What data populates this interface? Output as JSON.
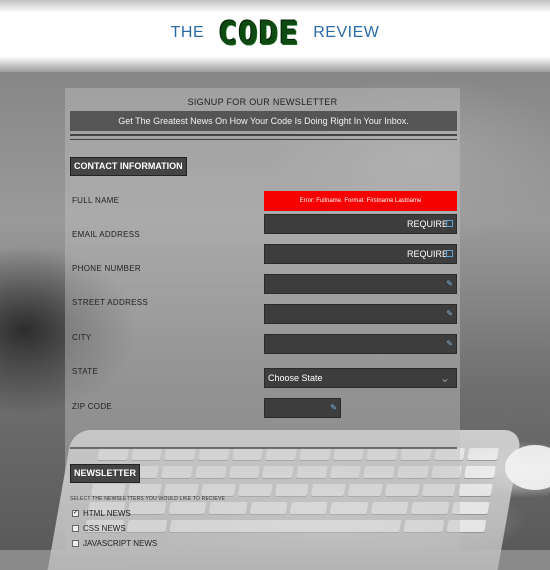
{
  "header": {
    "word_left": "THE",
    "logo": "CODE",
    "word_right": "REVIEW"
  },
  "signup": {
    "title": "SIGNUP FOR OUR NEWSLETTER",
    "tagline": "Get The Greatest News On How Your Code Is Doing Right In Your Inbox."
  },
  "contact": {
    "section_title": "CONTACT INFORMATION",
    "labels": {
      "full_name": "FULL NAME",
      "email": "EMAIL ADDRESS",
      "phone": "PHONE NUMBER",
      "street": "STREET ADDRESS",
      "city": "CITY",
      "state": "STATE",
      "zip": "ZIP CODE"
    },
    "error_message": "Error: Fullname. Format: Firstname Lastname",
    "required_text": "REQUIRE",
    "state_placeholder": "Choose State"
  },
  "newsletter": {
    "section_title": "NEWSLETTER",
    "instruction": "SELECT THE NEWSLETTERS YOU WOULD LIKE TO RECIEVE",
    "options": [
      {
        "label": "HTML NEWS",
        "checked": true
      },
      {
        "label": "CSS NEWS",
        "checked": false
      },
      {
        "label": "JAVASCRIPT NEWS",
        "checked": false
      }
    ]
  },
  "colors": {
    "brand_blue": "#2a6ba8",
    "logo_green": "#0f4a12",
    "error_red": "#f70000",
    "input_bg": "#3d3d3d"
  }
}
